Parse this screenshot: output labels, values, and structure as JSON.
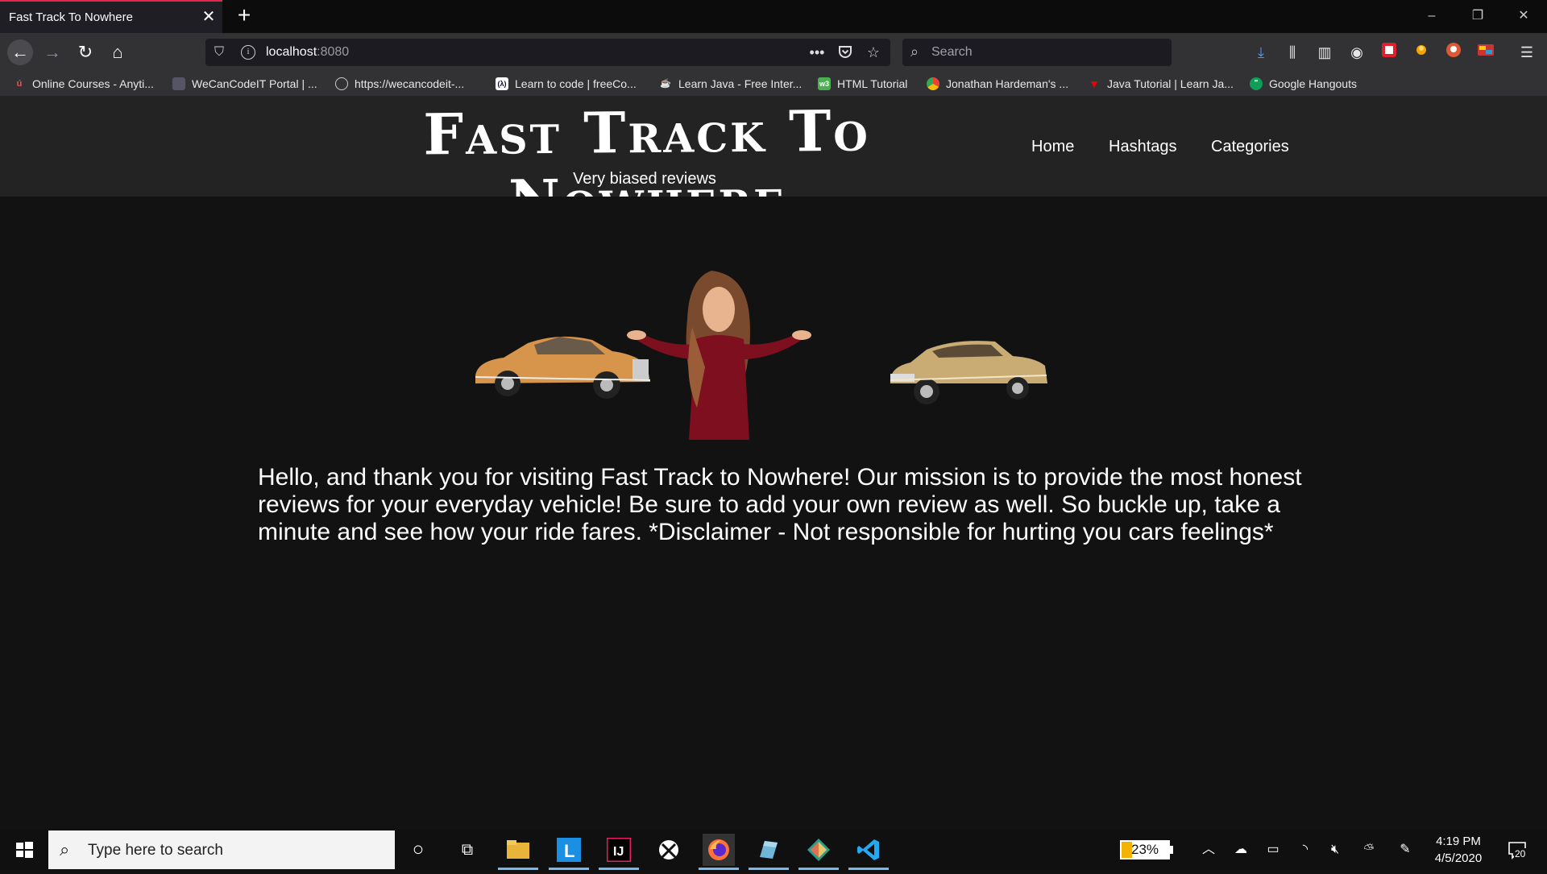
{
  "browser": {
    "tab_title": "Fast Track To Nowhere",
    "url_host": "localhost",
    "url_port": ":8080",
    "search_placeholder": "Search"
  },
  "bookmarks": [
    {
      "label": "Online Courses - Anyti...",
      "icon": "udemy-icon",
      "color": "#ec5252"
    },
    {
      "label": "WeCanCodeIT Portal | ...",
      "icon": "wecancodeit-icon",
      "color": "#556"
    },
    {
      "label": "https://wecancodeit-...",
      "icon": "globe-icon",
      "color": "#ccc"
    },
    {
      "label": "Learn to code | freeCo...",
      "icon": "freecodecamp-icon",
      "color": "#0a0a23"
    },
    {
      "label": "Learn Java - Free Inter...",
      "icon": "java-icon",
      "color": "#e76f00"
    },
    {
      "label": "HTML Tutorial",
      "icon": "w3schools-icon",
      "color": "#4caf50"
    },
    {
      "label": "Jonathan Hardeman's ...",
      "icon": "chrome-icon",
      "color": "#4285f4"
    },
    {
      "label": "Java Tutorial | Learn Ja...",
      "icon": "javatpoint-icon",
      "color": "#e00"
    },
    {
      "label": "Google Hangouts",
      "icon": "hangouts-icon",
      "color": "#0f9d58"
    }
  ],
  "site": {
    "title": "Fast Track To Nowhere",
    "subtitle": "Very biased reviews",
    "nav": [
      "Home",
      "Hashtags",
      "Categories"
    ],
    "intro": "Hello, and thank you for visiting Fast Track to Nowhere! Our mission is to provide the most honest reviews for your everyday vehicle! Be sure to add your own review as well. So buckle up, take a minute and see how your ride fares. *Disclaimer - Not responsible for hurting you cars feelings*"
  },
  "taskbar": {
    "search_placeholder": "Type here to search",
    "battery_percent": "23%",
    "battery_level": 0.23,
    "time": "4:19 PM",
    "date": "4/5/2020",
    "notification_count": "20"
  }
}
